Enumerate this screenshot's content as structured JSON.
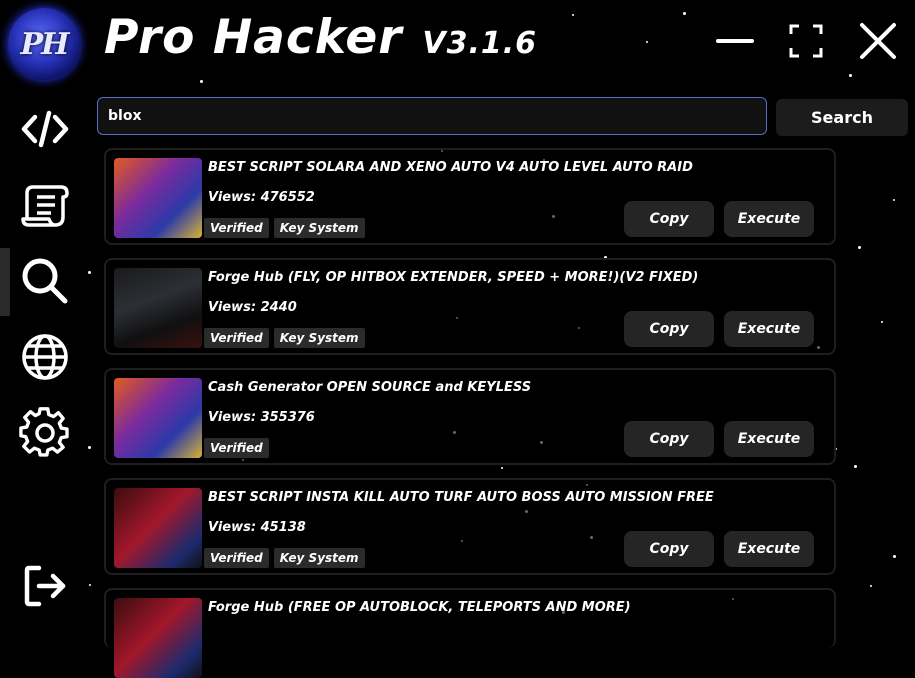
{
  "app": {
    "logo_text": "PH",
    "title": "Pro Hacker",
    "version": "V3.1.6"
  },
  "window_controls": [
    "minimize-icon",
    "maximize-icon",
    "close-icon"
  ],
  "sidebar": {
    "items": [
      {
        "name": "code",
        "icon": "code-icon"
      },
      {
        "name": "scripts",
        "icon": "scroll-icon"
      },
      {
        "name": "search",
        "icon": "search-icon",
        "active": true
      },
      {
        "name": "web",
        "icon": "globe-icon"
      },
      {
        "name": "settings",
        "icon": "gear-icon"
      }
    ],
    "logout_icon": "logout-icon"
  },
  "search": {
    "value": "blox",
    "button_label": "Search"
  },
  "colors": {
    "background": "#000000",
    "card_border": "#1e1e1e",
    "button_bg": "#252525",
    "tag_bg": "#2b2b2b",
    "search_border": "#5a6ec8"
  },
  "results": [
    {
      "title": "BEST SCRIPT SOLARA AND XENO AUTO V4 AUTO LEVEL AUTO RAID",
      "views": "Views: 476552",
      "tags": [
        "Verified",
        "Key System"
      ],
      "copy_label": "Copy",
      "execute_label": "Execute"
    },
    {
      "title": "Forge Hub (FLY, OP HITBOX EXTENDER, SPEED + MORE!)(V2 FIXED)",
      "views": "Views: 2440",
      "tags": [
        "Verified",
        "Key System"
      ],
      "copy_label": "Copy",
      "execute_label": "Execute"
    },
    {
      "title": "Cash Generator OPEN SOURCE and KEYLESS",
      "views": "Views: 355376",
      "tags": [
        "Verified"
      ],
      "copy_label": "Copy",
      "execute_label": "Execute"
    },
    {
      "title": "BEST SCRIPT INSTA KILL AUTO TURF AUTO BOSS AUTO MISSION FREE",
      "views": "Views: 45138",
      "tags": [
        "Verified",
        "Key System"
      ],
      "copy_label": "Copy",
      "execute_label": "Execute"
    },
    {
      "title": "Forge Hub (FREE OP AUTOBLOCK, TELEPORTS AND MORE)"
    }
  ]
}
